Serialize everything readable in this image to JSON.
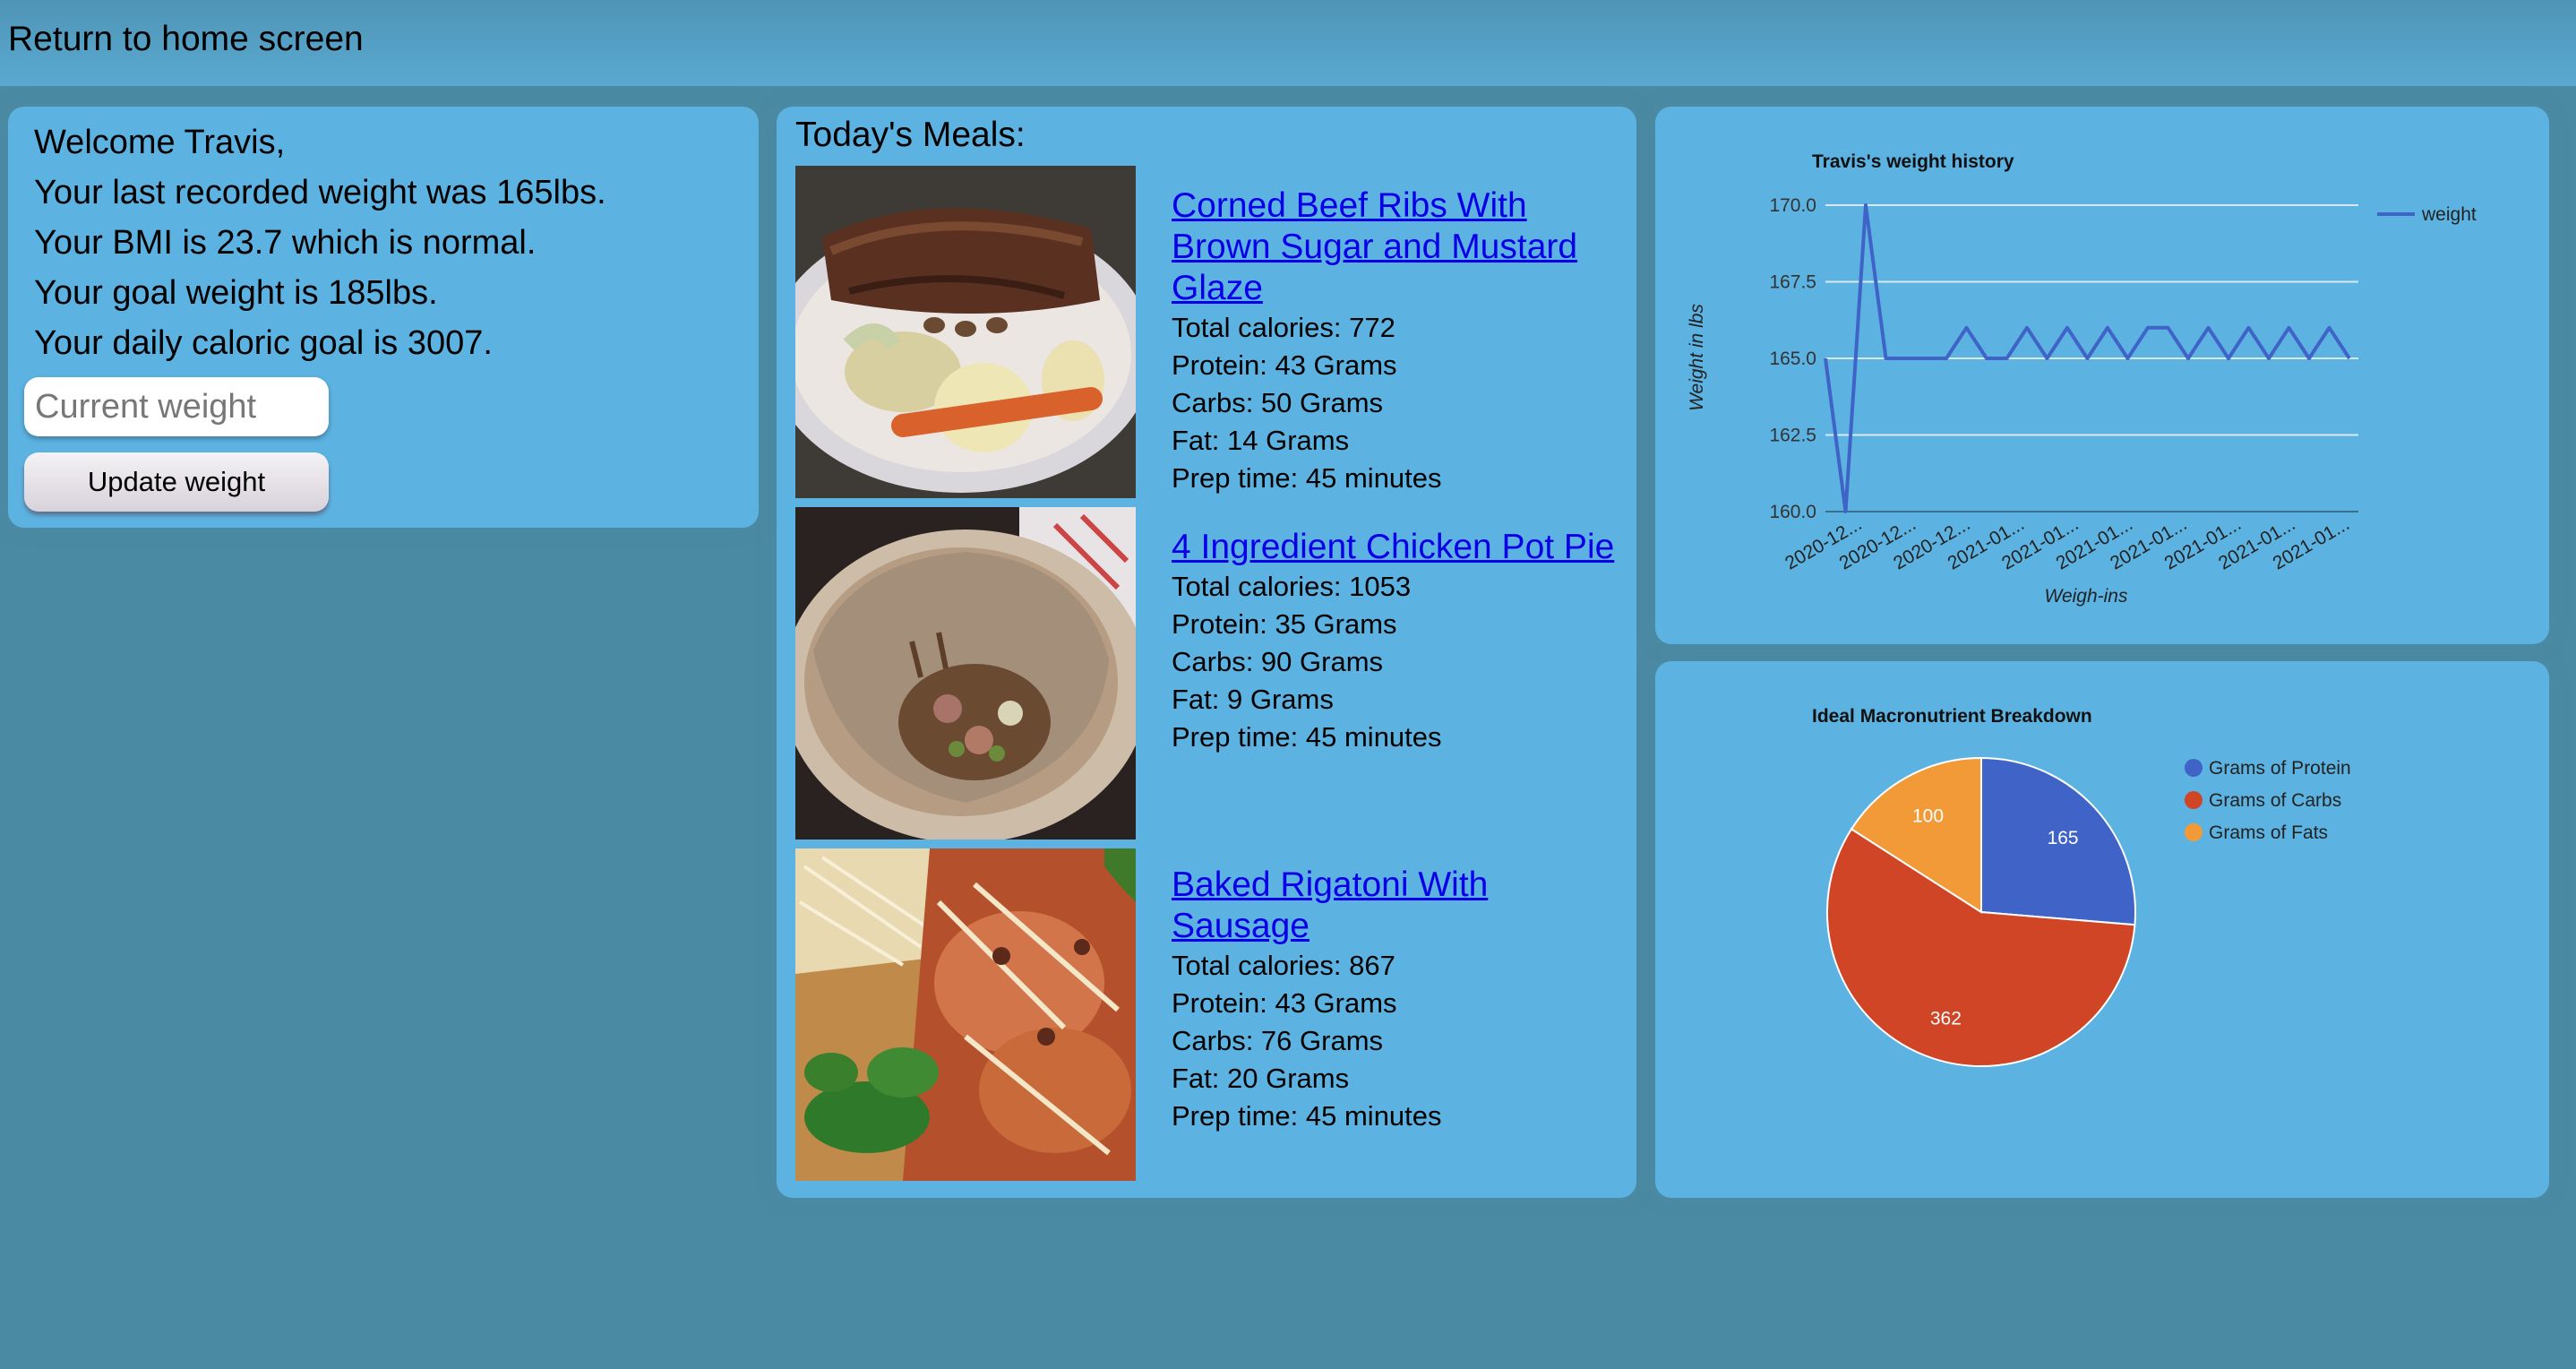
{
  "header": {
    "home_link": "Return to home screen"
  },
  "welcome": {
    "greeting": "Welcome Travis,",
    "last_weight": "Your last recorded weight was 165lbs.",
    "bmi": "Your BMI is 23.7 which is normal.",
    "goal_weight": "Your goal weight is 185lbs.",
    "caloric_goal": "Your daily caloric goal is 3007.",
    "input_placeholder": "Current weight",
    "update_button": "Update weight"
  },
  "meals": {
    "title": "Today's Meals:",
    "items": [
      {
        "name_lines": [
          "Corned Beef Ribs With",
          "Brown Sugar and Mustard",
          "Glaze"
        ],
        "calories": "Total calories: 772",
        "protein": "Protein: 43 Grams",
        "carbs": "Carbs: 50 Grams",
        "fat": "Fat: 14 Grams",
        "prep": "Prep time: 45 minutes",
        "photo_icon": "corned-beef-ribs-photo"
      },
      {
        "name_lines": [
          "4 Ingredient Chicken Pot Pie"
        ],
        "calories": "Total calories: 1053",
        "protein": "Protein: 35 Grams",
        "carbs": "Carbs: 90 Grams",
        "fat": "Fat: 9 Grams",
        "prep": "Prep time: 45 minutes",
        "photo_icon": "chicken-pot-pie-photo"
      },
      {
        "name_lines": [
          "Baked Rigatoni With",
          "Sausage"
        ],
        "calories": "Total calories: 867",
        "protein": "Protein: 43 Grams",
        "carbs": "Carbs: 76 Grams",
        "fat": "Fat: 20 Grams",
        "prep": "Prep time: 45 minutes",
        "photo_icon": "baked-rigatoni-photo"
      }
    ]
  },
  "chart_data": [
    {
      "type": "line",
      "title": "Travis's weight history",
      "xlabel": "Weigh-ins",
      "ylabel": "Weight in lbs",
      "ylim": [
        160,
        170
      ],
      "yticks": [
        "160.0",
        "162.5",
        "165.0",
        "167.5",
        "170.0"
      ],
      "xtick_labels": [
        "2020-12...",
        "2020-12...",
        "2020-12...",
        "2021-01...",
        "2021-01...",
        "2021-01...",
        "2021-01...",
        "2021-01...",
        "2021-01...",
        "2021-01..."
      ],
      "grid": true,
      "legend_position": "right",
      "series": [
        {
          "name": "weight",
          "color": "#3f63c7",
          "values": [
            165,
            160,
            170,
            165,
            165,
            165,
            165,
            166,
            165,
            165,
            166,
            165,
            166,
            165,
            166,
            165,
            166,
            166,
            165,
            166,
            165,
            166,
            165,
            166,
            165,
            166,
            165
          ]
        }
      ]
    },
    {
      "type": "pie",
      "title": "Ideal Macronutrient Breakdown",
      "legend_position": "right",
      "slices": [
        {
          "label": "Grams of Protein",
          "value": 165,
          "color": "#3f63c7"
        },
        {
          "label": "Grams of Carbs",
          "value": 362,
          "color": "#d04525"
        },
        {
          "label": "Grams of Fats",
          "value": 100,
          "color": "#f29a38"
        }
      ]
    }
  ]
}
